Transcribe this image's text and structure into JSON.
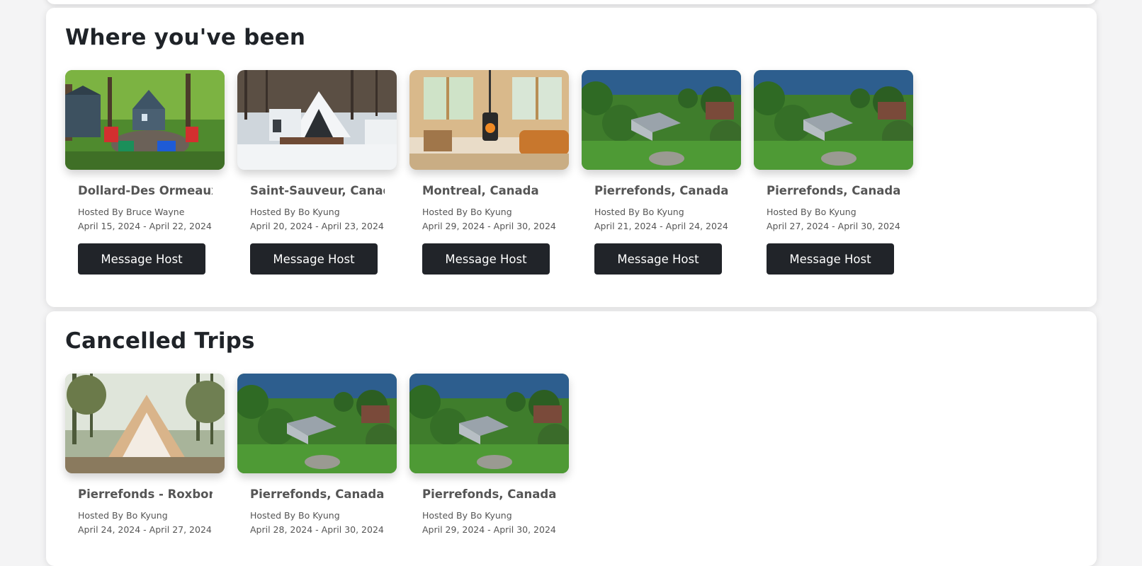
{
  "sections": {
    "been": {
      "title": "Where you've been",
      "trips": [
        {
          "place": "Dollard-Des Ormeaux, Canada",
          "host": "Hosted By Bruce Wayne",
          "dates": "April 15, 2024 - April 22, 2024",
          "button": "Message Host",
          "photo": "backyard-firepit-photo"
        },
        {
          "place": "Saint-Sauveur, Canada",
          "host": "Hosted By Bo Kyung",
          "dates": "April 20, 2024 - April 23, 2024",
          "button": "Message Host",
          "photo": "snowy-a-frame-photo"
        },
        {
          "place": "Montreal, Canada",
          "host": "Hosted By Bo Kyung",
          "dates": "April 29, 2024 - April 30, 2024",
          "button": "Message Host",
          "photo": "living-room-stove-photo"
        },
        {
          "place": "Pierrefonds, Canada",
          "host": "Hosted By Bo Kyung",
          "dates": "April 21, 2024 - April 24, 2024",
          "button": "Message Host",
          "photo": "lakeside-house-aerial-photo"
        },
        {
          "place": "Pierrefonds, Canada",
          "host": "Hosted By Bo Kyung",
          "dates": "April 27, 2024 - April 30, 2024",
          "button": "Message Host",
          "photo": "lakeside-house-aerial-photo"
        }
      ]
    },
    "cancelled": {
      "title": "Cancelled Trips",
      "trips": [
        {
          "place": "Pierrefonds - Roxboro",
          "host": "Hosted By Bo Kyung",
          "dates": "April 24, 2024 - April 27, 2024",
          "photo": "a-frame-tent-photo"
        },
        {
          "place": "Pierrefonds, Canada",
          "host": "Hosted By Bo Kyung",
          "dates": "April 28, 2024 - April 30, 2024",
          "photo": "lakeside-house-aerial-photo"
        },
        {
          "place": "Pierrefonds, Canada",
          "host": "Hosted By Bo Kyung",
          "dates": "April 29, 2024 - April 30, 2024",
          "photo": "lakeside-house-aerial-photo"
        }
      ]
    }
  },
  "colors": {
    "button_bg": "#212429",
    "button_text": "#ffffff",
    "title": "#1f2328",
    "muted_text": "#555555"
  }
}
